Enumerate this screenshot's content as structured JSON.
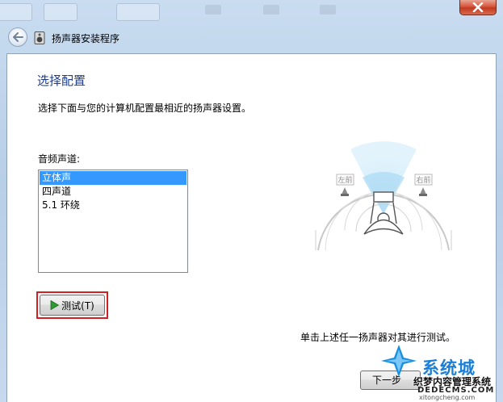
{
  "window": {
    "title": "扬声器安装程序",
    "close_icon": "close-icon",
    "back_icon": "back-arrow-icon"
  },
  "page": {
    "heading": "选择配置",
    "description": "选择下面与您的计算机配置最相近的扬声器设置。",
    "channel_label": "音频声道:",
    "channels": [
      "立体声",
      "四声道",
      "5.1 环绕"
    ],
    "selected_channel": "立体声",
    "test_button": "测试(T)",
    "hint": "单击上述任一扬声器对其进行测试。",
    "next_button": "下一步"
  },
  "diagram": {
    "left_front": "左前",
    "right_front": "右前"
  },
  "watermark": {
    "brand": "系统城",
    "subtitle": "织梦内容管理系统",
    "url_text": "DEDECMS.COM",
    "small_url": "xitongcheng.com"
  },
  "colors": {
    "heading": "#1d3d8c",
    "selection": "#3399ff",
    "highlight_border": "#d11f26",
    "close_button": "#c23a20"
  }
}
